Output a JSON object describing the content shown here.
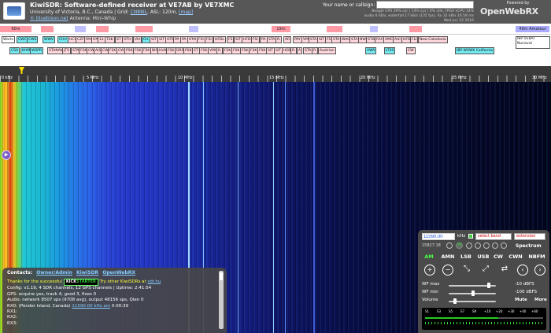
{
  "header": {
    "title": "KiwiSDR: Software-defined receiver at VE7AB by VE7XMC",
    "location_prefix": "University of Victoria, B.C., Canada | Grid: ",
    "grid": "CN88IL",
    "asl": ", ASL: 120m, ",
    "map_link": "[map]",
    "sub_link": "© bluebison.net",
    "antenna": " Antenna: Mini-Whip",
    "callsign_label": "Your name or callsign:",
    "callsign_value": "",
    "stats_line1": "Beagle CPU 39% usr | 14% sys | 0% idle, FPGA eCPU 14%",
    "stats_line2": "audio 0 kB/s, waterfall 17 kB/s (135 fps), Rx 32 kB/s 16.58 ms",
    "stats_line3": "Wed Jun 22 2016",
    "powered_by": "Powered by",
    "owrx_logo": "OpenWebRX"
  },
  "band_bar": [
    {
      "label": "90m",
      "color": "#ff4d5a",
      "left": 0,
      "width": 0
    },
    {
      "label": "19m",
      "color": "#ff4d5a"
    },
    {
      "label": "49m Amateur",
      "color": "#aaaaff"
    }
  ],
  "labels_row1": [
    "Warts",
    "CWC",
    "CWS",
    "WWV",
    "CHU",
    "HCI",
    "CZF",
    "PAI",
    "IFA",
    "12",
    "TSK",
    "ST",
    "OTH",
    "VIA",
    "CH",
    "SIT",
    "SIT",
    "OTE",
    "PA",
    "PA",
    "IFMI",
    "FSI",
    "FSI",
    "HFDL",
    "FS",
    "SIT",
    "HFD",
    "FSI",
    "PA",
    "STA",
    "R.",
    "AR",
    "PAY",
    "VM",
    "STA",
    "SIT",
    "FS",
    "STA",
    "WAG",
    "STA",
    "NWI",
    "STW",
    "FAX",
    "VMC",
    "AUI",
    "HFD",
    "FLI",
    "New Caledonia",
    "IBP VE8AT Nunavut"
  ],
  "labels_row2": [
    "CSU",
    "KHM",
    "WSPR",
    "STANAV",
    "JTS",
    "STA",
    "FSK",
    "CW",
    "AIS",
    "CW",
    "FSK",
    "CWI",
    "PSK",
    "FSK",
    "FSK",
    "BIS",
    "HUM",
    "FSK",
    "DRS",
    "PSK",
    "ST",
    "FSK",
    "VMI",
    "R.",
    "FSK",
    "FSK",
    "FSK",
    "FSK",
    "FSK",
    "SIT",
    "SIT",
    "HEB",
    "R.",
    "A",
    "STA",
    "R.",
    "Austrian",
    "VWA",
    "LTSS",
    "CW",
    "IBP WSWK California"
  ],
  "scale": {
    "labels": [
      "0 kHz",
      "5 MHz",
      "10 MHz",
      "15 MHz",
      "20 MHz",
      "25 MHz",
      "30 MHz"
    ]
  },
  "info": {
    "contacts_label": "Contacts:",
    "contact_links": [
      "Owner/Admin",
      "KiwiSDR",
      "OpenWebRX"
    ],
    "thanks_prefix": "Thanks for the successful",
    "kick_label": "KICK",
    "starter_label": "STARTER",
    "try_text": "Try other KiwiSDRs at",
    "try_link": "sdr.hu",
    "config_line": "Config: v1.19, 4 SDR channels, 12 GPS channels | Uptime: 2:41:54",
    "gps_line": "GPS: acquire yes, track 4, good 3, fixes 0",
    "audio_line": "Audio: network 8507 sps (9708 avg), output 48156 sps, Qlen 0",
    "rx0_prefix": "RX0: (Pender Island, Canada)",
    "rx0_freq": "11590.00 kHz am",
    "rx0_time": "0:00:39",
    "rx1": "RX1:",
    "rx2": "RX2:",
    "rx3": "RX3:"
  },
  "control": {
    "freq_value": "11590.00",
    "freq_unit": "kHz",
    "band_select": "select band",
    "ext_select": "extension",
    "passband": "15827.18",
    "step_label": "10",
    "spectrum_label": "Spectrum",
    "modes": [
      "AM",
      "AMN",
      "LSB",
      "USB",
      "CW",
      "CWN",
      "NBFM"
    ],
    "wf_max_label": "WF max",
    "wf_max_value": "-10 dBFS",
    "wf_max_level": 0.85,
    "wf_min_label": "WF min",
    "wf_min_value": "-100 dBFS",
    "wf_min_level": 0.5,
    "volume_label": "Volume",
    "volume_level": 0.1,
    "mute_label": "Mute",
    "more_label": "More",
    "smeter_ticks": [
      "S1",
      "S3",
      "S5",
      "S7",
      "S9",
      "+10",
      "+20",
      "+30",
      "+40",
      "+60"
    ],
    "smeter_level": 0.62
  }
}
